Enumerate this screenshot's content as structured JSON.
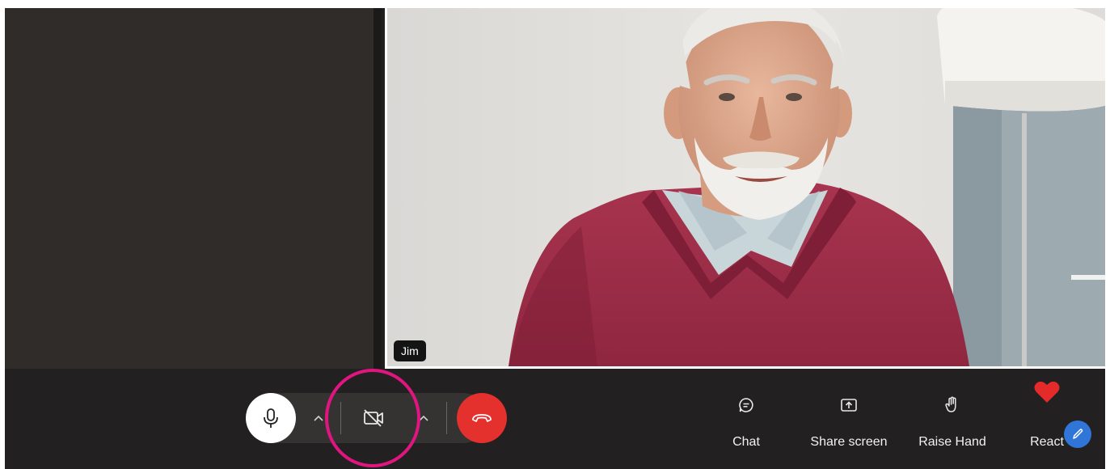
{
  "participants": {
    "main_speaker": {
      "name": "Jim"
    }
  },
  "toolbar": {
    "mic": {
      "icon": "microphone-icon",
      "state": "on"
    },
    "mic_options": {
      "icon": "chevron-up-icon"
    },
    "camera": {
      "icon": "camera-off-icon",
      "state": "off",
      "highlighted": true
    },
    "camera_options": {
      "icon": "chevron-up-icon"
    },
    "hangup": {
      "icon": "hang-up-icon",
      "color": "#e5312d"
    },
    "actions": {
      "chat": {
        "label": "Chat",
        "icon": "chat-icon"
      },
      "share": {
        "label": "Share screen",
        "icon": "share-screen-icon"
      },
      "raise": {
        "label": "Raise Hand",
        "icon": "raise-hand-icon"
      },
      "react": {
        "label": "React",
        "icon": "heart-icon",
        "color": "#e52a2a"
      }
    },
    "edit": {
      "icon": "pencil-icon",
      "color": "#2f76d8"
    }
  },
  "colors": {
    "background": "#211f1e",
    "highlight": "#e0157f"
  }
}
